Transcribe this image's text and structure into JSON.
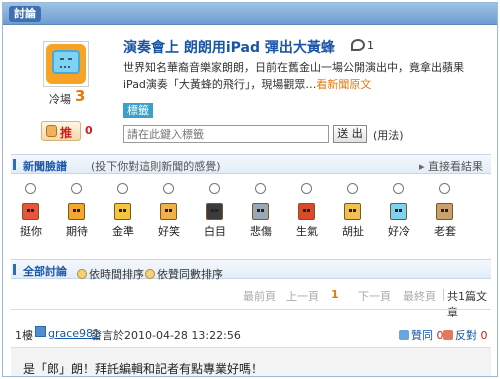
{
  "header": {
    "title": "討論"
  },
  "news": {
    "mood_label": "冷場",
    "mood_count": "3",
    "title": "演奏會上 朗朗用iPad 彈出大黃蜂",
    "comment_count": "1",
    "summary_line1": "世界知名華裔音樂家朗朗，日前在舊金山一場公開演出中，竟拿出蘋果",
    "summary_line2": "iPad演奏「大黃蜂的飛行」，現場觀眾…",
    "more_link": "看新聞原文",
    "push_label": "推",
    "push_count": "0"
  },
  "tags": {
    "label": "標籤",
    "placeholder": "請在此鍵入標籤",
    "submit": "送 出",
    "usage": "(用法)"
  },
  "mood_section": {
    "title": "新聞臉譜",
    "hint": "(投下你對這則新聞的感覺)",
    "link": "直接看結果",
    "moods": [
      {
        "name": "挺你",
        "color": "#e8553d"
      },
      {
        "name": "期待",
        "color": "#f3a72f"
      },
      {
        "name": "金準",
        "color": "#f5c542"
      },
      {
        "name": "好笑",
        "color": "#f2b04a"
      },
      {
        "name": "白目",
        "color": "#3b3b3b"
      },
      {
        "name": "悲傷",
        "color": "#9aa8b5"
      },
      {
        "name": "生氣",
        "color": "#d94a2b"
      },
      {
        "name": "胡扯",
        "color": "#f0c050"
      },
      {
        "name": "好冷",
        "color": "#7fd3f2"
      },
      {
        "name": "老套",
        "color": "#c9a26b"
      }
    ]
  },
  "discussion": {
    "title": "全部討論",
    "sort_time": "依時間排序",
    "sort_agree": "依贊同數排序",
    "pager": {
      "first": "最前頁",
      "prev": "上一頁",
      "current": "1",
      "next": "下一頁",
      "last": "最終頁",
      "total": "共1篇文章"
    }
  },
  "comment": {
    "floor": "1樓",
    "user": "grace981",
    "time": "發言於2010-04-28 13:22:56",
    "agree": "贊同",
    "agree_count": "0",
    "oppose": "反對",
    "oppose_count": "0",
    "text": "是「郎」朗！拜託編輯和記者有點專業好嗎！"
  }
}
